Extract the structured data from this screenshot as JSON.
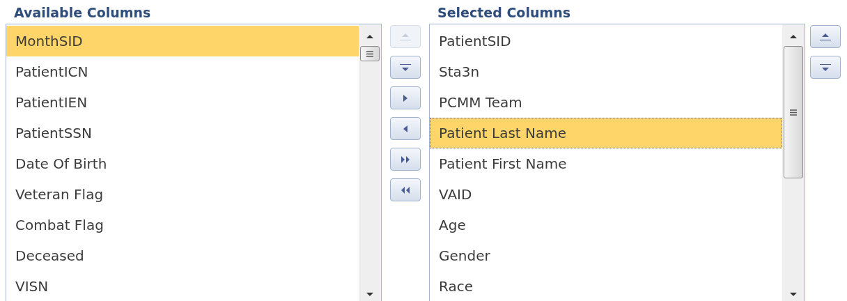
{
  "available": {
    "title": "Available Columns",
    "items": [
      {
        "label": "MonthSID",
        "selected": true
      },
      {
        "label": "PatientICN",
        "selected": false
      },
      {
        "label": "PatientIEN",
        "selected": false
      },
      {
        "label": "PatientSSN",
        "selected": false
      },
      {
        "label": "Date Of Birth",
        "selected": false
      },
      {
        "label": "Veteran Flag",
        "selected": false
      },
      {
        "label": "Combat Flag",
        "selected": false
      },
      {
        "label": "Deceased",
        "selected": false
      },
      {
        "label": "VISN",
        "selected": false
      }
    ]
  },
  "transfer_buttons": [
    {
      "kind": "up",
      "disabled": true
    },
    {
      "kind": "down",
      "disabled": false
    },
    {
      "kind": "add",
      "disabled": false
    },
    {
      "kind": "remove",
      "disabled": false
    },
    {
      "kind": "add-all",
      "disabled": false
    },
    {
      "kind": "remove-all",
      "disabled": false
    }
  ],
  "selected": {
    "title": "Selected Columns",
    "items": [
      {
        "label": "PatientSID",
        "selected": false,
        "focused": false
      },
      {
        "label": "Sta3n",
        "selected": false,
        "focused": false
      },
      {
        "label": "PCMM Team",
        "selected": false,
        "focused": false
      },
      {
        "label": "Patient Last Name",
        "selected": true,
        "focused": true
      },
      {
        "label": "Patient First Name",
        "selected": false,
        "focused": false
      },
      {
        "label": "VAID",
        "selected": false,
        "focused": false
      },
      {
        "label": "Age",
        "selected": false,
        "focused": false
      },
      {
        "label": "Gender",
        "selected": false,
        "focused": false
      },
      {
        "label": "Race",
        "selected": false,
        "focused": false
      }
    ]
  },
  "order_buttons": [
    {
      "kind": "up",
      "disabled": false
    },
    {
      "kind": "down",
      "disabled": false
    }
  ]
}
